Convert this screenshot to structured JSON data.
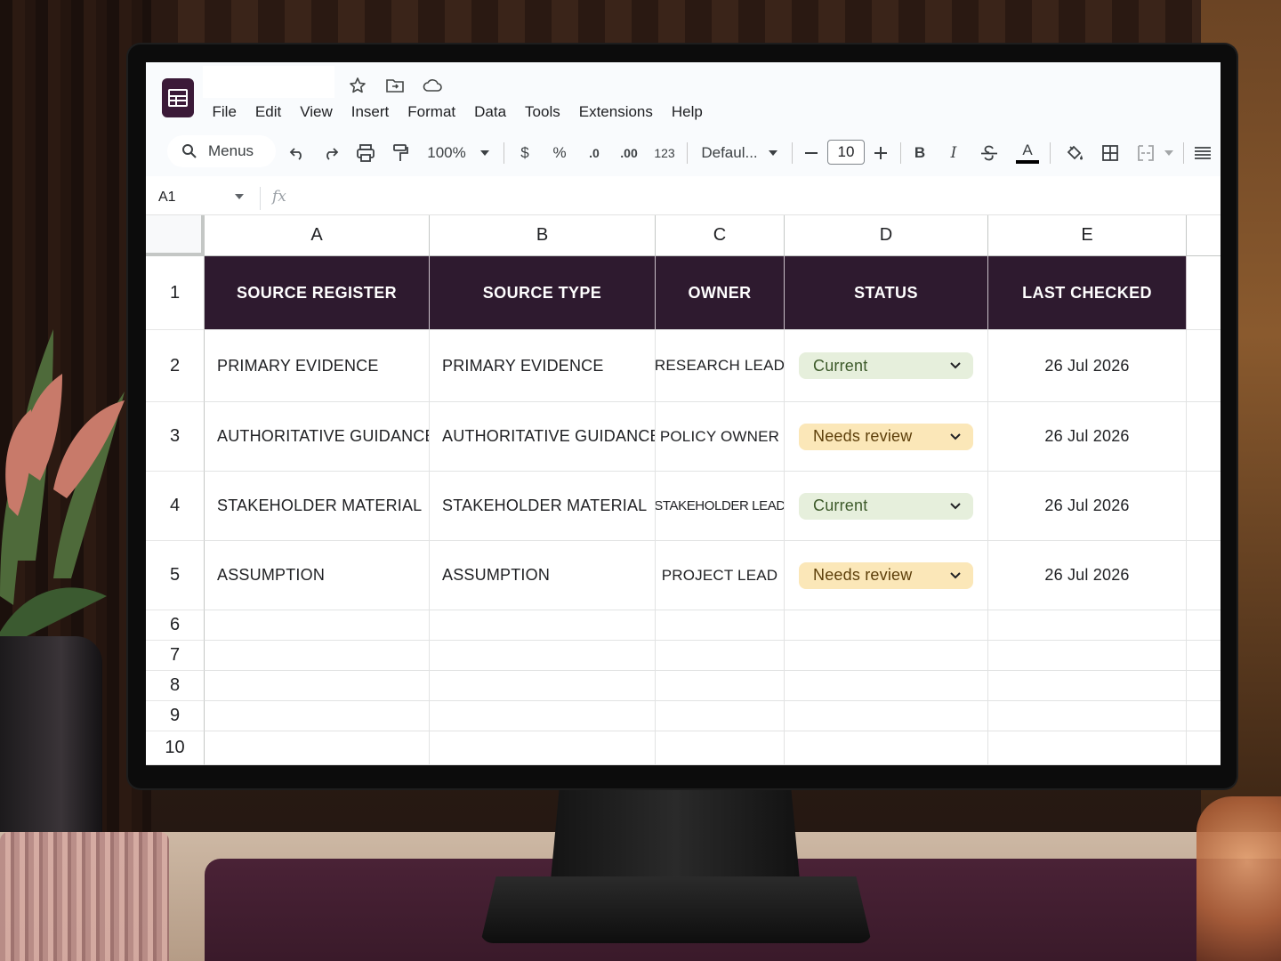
{
  "app": {
    "menu": [
      "File",
      "Edit",
      "View",
      "Insert",
      "Format",
      "Data",
      "Tools",
      "Extensions",
      "Help"
    ],
    "header_icons": [
      "star-icon",
      "move-to-folder-icon",
      "cloud-status-icon"
    ]
  },
  "toolbar": {
    "search_label": "Menus",
    "zoom": "100%",
    "currency": "$",
    "percent": "%",
    "decrease_decimal": ".0",
    "increase_decimal": ".00",
    "number_format": "123",
    "font": "Defaul...",
    "font_size": "10",
    "bold": "B",
    "italic": "I",
    "text_color": "A"
  },
  "formula_bar": {
    "cell_ref": "A1",
    "fx": "fx",
    "value": ""
  },
  "columns": [
    "A",
    "B",
    "C",
    "D",
    "E"
  ],
  "rows": [
    "1",
    "2",
    "3",
    "4",
    "5",
    "6",
    "7",
    "8",
    "9",
    "10"
  ],
  "table": {
    "headers": [
      "SOURCE REGISTER",
      "SOURCE TYPE",
      "OWNER",
      "STATUS",
      "LAST CHECKED"
    ],
    "rows": [
      {
        "register": "PRIMARY EVIDENCE",
        "type": "PRIMARY EVIDENCE",
        "owner": "RESEARCH LEAD",
        "status": "Current",
        "checked": "26 Jul 2026"
      },
      {
        "register": "AUTHORITATIVE GUIDANCE",
        "type": "AUTHORITATIVE GUIDANCE",
        "owner": "POLICY OWNER",
        "status": "Needs review",
        "checked": "26 Jul 2026"
      },
      {
        "register": "STAKEHOLDER MATERIAL",
        "type": "STAKEHOLDER MATERIAL",
        "owner": "STAKEHOLDER LEAD",
        "status": "Current",
        "checked": "26 Jul 2026"
      },
      {
        "register": "ASSUMPTION",
        "type": "ASSUMPTION",
        "owner": "PROJECT LEAD",
        "status": "Needs review",
        "checked": "26 Jul 2026"
      }
    ]
  },
  "colors": {
    "header_fill": "#2e1a2f",
    "status_current": "#e6efdc",
    "status_needs_review": "#fbe7b8",
    "app_logo": "#3b1a38"
  }
}
